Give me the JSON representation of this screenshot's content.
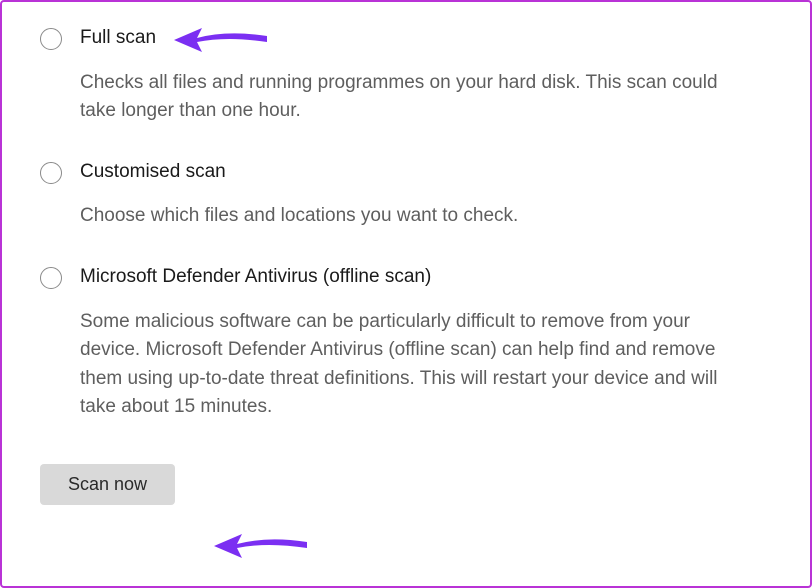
{
  "options": [
    {
      "label": "Full scan",
      "description": "Checks all files and running programmes on your hard disk. This scan could take longer than one hour."
    },
    {
      "label": "Customised scan",
      "description": "Choose which files and locations you want to check."
    },
    {
      "label": "Microsoft Defender Antivirus (offline scan)",
      "description": "Some malicious software can be particularly difficult to remove from your device. Microsoft Defender Antivirus (offline scan) can help find and remove them using up-to-date threat definitions. This will restart your device and will take about 15 minutes."
    }
  ],
  "button": {
    "label": "Scan now"
  },
  "accent_color": "#7b2ff2"
}
